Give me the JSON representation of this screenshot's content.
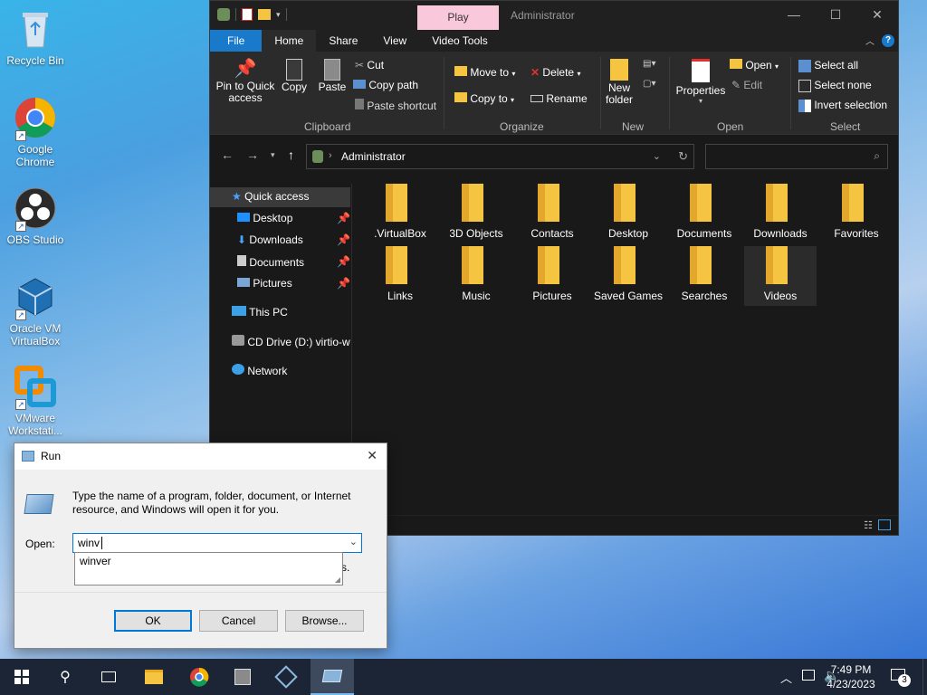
{
  "desktop": {
    "icons": [
      {
        "label": "Recycle Bin",
        "icon": "recycle-bin-icon"
      },
      {
        "label": "Google Chrome",
        "icon": "chrome-icon"
      },
      {
        "label": "OBS Studio",
        "icon": "obs-icon"
      },
      {
        "label": "Oracle VM VirtualBox",
        "icon": "virtualbox-icon"
      },
      {
        "label": "VMware Workstati...",
        "icon": "vmware-icon"
      }
    ]
  },
  "explorer": {
    "title": "Administrator",
    "context_tab": "Play",
    "tabs": [
      "File",
      "Home",
      "Share",
      "View",
      "Video Tools"
    ],
    "ribbon": {
      "clipboard": {
        "pin": "Pin to Quick access",
        "copy": "Copy",
        "paste": "Paste",
        "cut": "Cut",
        "copy_path": "Copy path",
        "paste_shortcut": "Paste shortcut",
        "group": "Clipboard"
      },
      "organize": {
        "move_to": "Move to",
        "copy_to": "Copy to",
        "delete": "Delete",
        "rename": "Rename",
        "group": "Organize"
      },
      "new": {
        "new_folder": "New folder",
        "group": "New"
      },
      "open": {
        "properties": "Properties",
        "open": "Open",
        "edit": "Edit",
        "group": "Open"
      },
      "select": {
        "select_all": "Select all",
        "select_none": "Select none",
        "invert": "Invert selection",
        "group": "Select"
      }
    },
    "address": {
      "path": "Administrator"
    },
    "nav": {
      "quick_access": "Quick access",
      "pinned": [
        "Desktop",
        "Downloads",
        "Documents",
        "Pictures"
      ],
      "this_pc": "This PC",
      "cd_drive": "CD Drive (D:) virtio-w",
      "network": "Network"
    },
    "folders": [
      ".VirtualBox",
      "3D Objects",
      "Contacts",
      "Desktop",
      "Documents",
      "Downloads",
      "Favorites",
      "Links",
      "Music",
      "Pictures",
      "Saved Games",
      "Searches",
      "Videos"
    ]
  },
  "run_dialog": {
    "title": "Run",
    "description": "Type the name of a program, folder, document, or Internet resource, and Windows will open it for you.",
    "open_label": "Open:",
    "input_value": "winv",
    "suggestion": "winver",
    "partial_hidden_text": "s.",
    "ok": "OK",
    "cancel": "Cancel",
    "browse": "Browse..."
  },
  "taskbar": {
    "time": "7:49 PM",
    "date": "4/23/2023",
    "notifications": "3"
  }
}
